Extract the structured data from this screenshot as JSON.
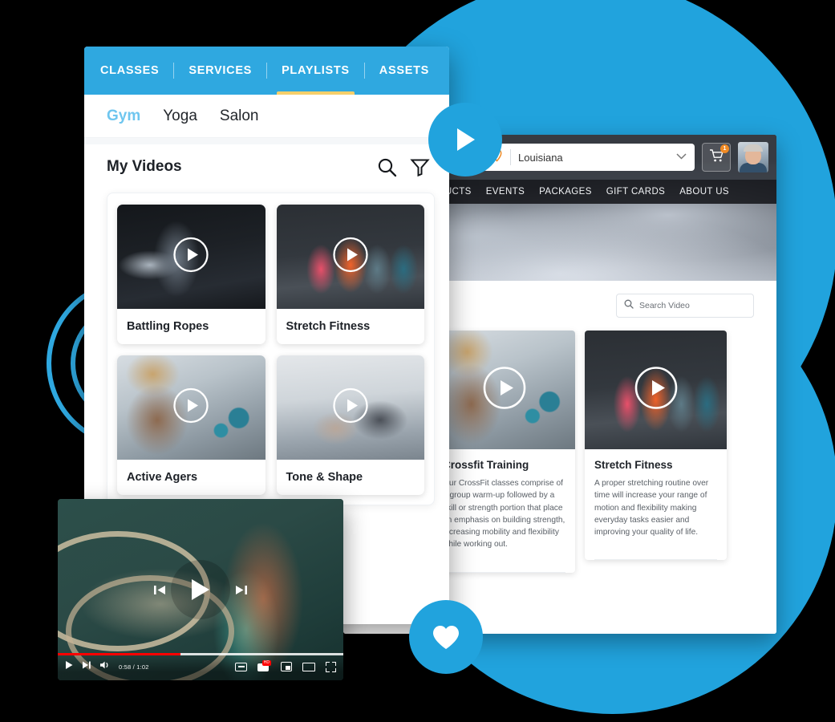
{
  "app": {
    "topnav": [
      {
        "label": "CLASSES",
        "active": false
      },
      {
        "label": "SERVICES",
        "active": false
      },
      {
        "label": "PLAYLISTS",
        "active": true
      },
      {
        "label": "ASSETS",
        "active": false
      }
    ],
    "subnav": [
      {
        "label": "Gym",
        "active": true
      },
      {
        "label": "Yoga",
        "active": false
      },
      {
        "label": "Salon",
        "active": false
      }
    ],
    "header": {
      "title": "My Videos",
      "search_icon": "search-icon",
      "filter_icon": "filter-icon"
    },
    "videos": [
      {
        "title": "Battling Ropes",
        "play_icon": "play-icon",
        "art": "art-ropes"
      },
      {
        "title": "Stretch Fitness",
        "play_icon": "play-icon",
        "art": "art-stretch"
      },
      {
        "title": "Active Agers",
        "play_icon": "play-icon",
        "art": "art-kettlebell"
      },
      {
        "title": "Tone & Shape",
        "play_icon": "play-icon",
        "art": "art-tone"
      }
    ]
  },
  "browser": {
    "location": {
      "pin_icon": "location-pin-icon",
      "value": "Louisiana",
      "chevron_icon": "chevron-down-icon"
    },
    "cart": {
      "icon": "shopping-cart-icon",
      "badge": "1"
    },
    "avatar": "user-avatar",
    "nav": [
      "PRODUCTS",
      "EVENTS",
      "PACKAGES",
      "GIFT CARDS",
      "ABOUT US"
    ],
    "search": {
      "icon": "search-icon",
      "placeholder": "Search Video"
    },
    "cards": [
      {
        "title": "Crossfit Training",
        "description": "Our CrossFit classes comprise of a group warm-up followed by a skill or strength portion that place an emphasis on building strength, increasing mobility and flexibility while working out.",
        "play_icon": "play-icon",
        "art": "art-kettlebell"
      },
      {
        "title": "Stretch Fitness",
        "description": "A proper stretching routine over time will increase your range of motion and flexibility making everyday tasks easier and improving your quality of life.",
        "play_icon": "play-icon",
        "art": "art-stretch"
      }
    ]
  },
  "player": {
    "prev_icon": "previous-track-icon",
    "play_icon": "play-icon",
    "next_icon": "next-track-icon",
    "bar": {
      "play_icon": "play-icon",
      "next_icon": "next-track-icon",
      "volume_icon": "volume-icon",
      "time": "0:58 / 1:02",
      "captions_icon": "captions-icon",
      "youtube_icon": "youtube-icon",
      "miniplayer_icon": "miniplayer-icon",
      "theater_icon": "theater-mode-icon",
      "fullscreen_icon": "fullscreen-icon"
    }
  },
  "decor": {
    "play_badge_icon": "play-icon",
    "heart_badge_icon": "heart-icon",
    "accent_blue": "#2fa8e0",
    "accent_yellow": "#f6cf6a",
    "accent_orange": "#f08a24"
  }
}
